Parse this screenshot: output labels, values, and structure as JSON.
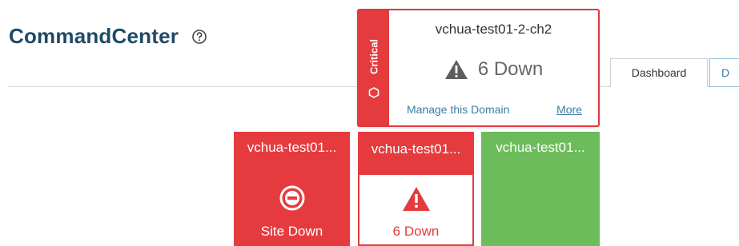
{
  "header": {
    "app_title": "CommandCenter",
    "help_icon": "help-circle-icon"
  },
  "tabs": [
    {
      "label": "Dashboard",
      "active": true
    },
    {
      "label": "D",
      "active": false
    }
  ],
  "popover": {
    "status_label": "Critical",
    "status_icon": "hexagon-icon",
    "title": "vchua-test01-2-ch2",
    "status_icon_main": "warning-triangle-icon",
    "down_text": "6 Down",
    "manage_link": "Manage this Domain",
    "more_link": "More",
    "accent_color": "#e53b3f"
  },
  "tiles": [
    {
      "title": "vchua-test01...",
      "state": "site-down",
      "icon": "no-entry-icon",
      "label": "Site Down",
      "color": "#e53b3f"
    },
    {
      "title": "vchua-test01...",
      "state": "alert",
      "icon": "warning-triangle-icon",
      "label": "6 Down",
      "color": "#e53b3f"
    },
    {
      "title": "vchua-test01...",
      "state": "ok",
      "icon": "",
      "label": "",
      "color": "#6cbc5b"
    }
  ],
  "colors": {
    "critical_red": "#e53b3f",
    "ok_green": "#6cbc5b",
    "title_blue": "#1f4a66",
    "link_blue": "#3b7ea1"
  }
}
